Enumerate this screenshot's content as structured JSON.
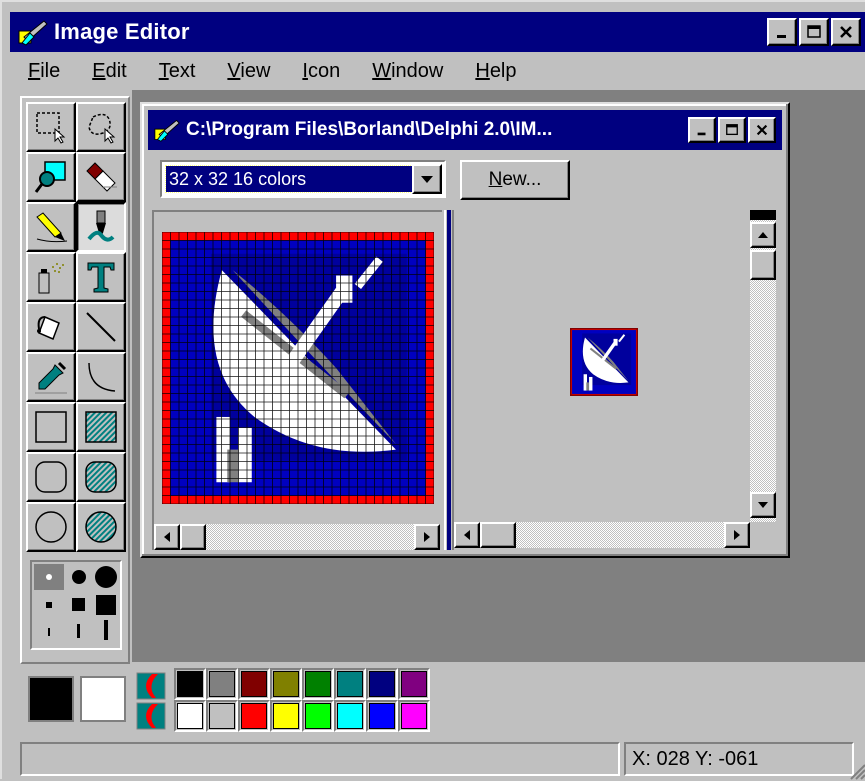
{
  "window": {
    "title": "Image Editor",
    "caption_buttons": [
      "minimize",
      "maximize",
      "close"
    ]
  },
  "menu": [
    {
      "underline": "F",
      "rest": "ile"
    },
    {
      "underline": "E",
      "rest": "dit"
    },
    {
      "underline": "T",
      "rest": "ext"
    },
    {
      "underline": "V",
      "rest": "iew"
    },
    {
      "underline": "I",
      "rest": "con"
    },
    {
      "underline": "W",
      "rest": "indow"
    },
    {
      "underline": "H",
      "rest": "elp"
    }
  ],
  "tools": [
    {
      "name": "rect-select-icon",
      "active": false
    },
    {
      "name": "lasso-select-icon",
      "active": false
    },
    {
      "name": "zoom-icon",
      "active": false
    },
    {
      "name": "eraser-icon",
      "active": false
    },
    {
      "name": "pencil-icon",
      "active": false
    },
    {
      "name": "brush-icon",
      "active": true
    },
    {
      "name": "spray-can-icon",
      "active": false
    },
    {
      "name": "text-icon",
      "active": false
    },
    {
      "name": "paint-bucket-icon",
      "active": false
    },
    {
      "name": "line-icon",
      "active": false
    },
    {
      "name": "eyedropper-icon",
      "active": false
    },
    {
      "name": "curve-icon",
      "active": false
    },
    {
      "name": "rectangle-icon",
      "active": false
    },
    {
      "name": "filled-rectangle-icon",
      "active": false
    },
    {
      "name": "rounded-rectangle-icon",
      "active": false
    },
    {
      "name": "filled-rounded-rectangle-icon",
      "active": false
    },
    {
      "name": "ellipse-icon",
      "active": false
    },
    {
      "name": "filled-ellipse-icon",
      "active": false
    }
  ],
  "child_window": {
    "title": "C:\\Program Files\\Borland\\Delphi 2.0\\IM...",
    "size_select": {
      "value": "32 x 32  16 colors"
    },
    "new_button": {
      "underline": "N",
      "rest": "ew..."
    }
  },
  "palette": {
    "foreground": "#000000",
    "background": "#ffffff",
    "colors": [
      "#000000",
      "#808080",
      "#800000",
      "#808000",
      "#008000",
      "#008080",
      "#000080",
      "#800080",
      "#ffffff",
      "#c0c0c0",
      "#ff0000",
      "#ffff00",
      "#00ff00",
      "#00ffff",
      "#0000ff",
      "#ff00ff"
    ]
  },
  "status": {
    "message": "",
    "coords": "X: 028  Y: -061"
  }
}
